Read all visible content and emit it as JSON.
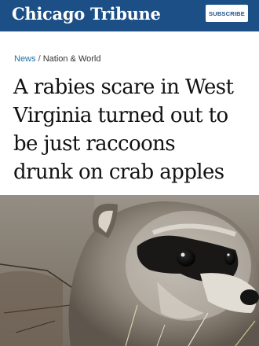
{
  "header": {
    "logo_text": "Chicago Tribune",
    "subscribe_label": "SUBSCRIBE",
    "brand_color": "#1d4f87"
  },
  "breadcrumb": {
    "section": "News",
    "separator": "/",
    "subsection": "Nation & World"
  },
  "article": {
    "headline_lines": [
      "A rabies scare in West",
      "Virginia turned out to",
      "be just raccoons",
      "drunk on crab apples"
    ]
  },
  "photo": {
    "subject": "raccoon"
  }
}
